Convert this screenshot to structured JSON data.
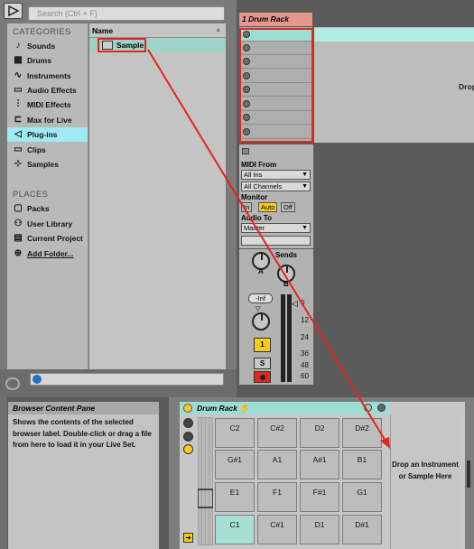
{
  "search": {
    "placeholder": "Search (Ctrl + F)"
  },
  "categories": {
    "title": "CATEGORIES",
    "items": [
      {
        "label": "Sounds",
        "icon": "note-icon"
      },
      {
        "label": "Drums",
        "icon": "drums-grid-icon"
      },
      {
        "label": "Instruments",
        "icon": "waveform-icon"
      },
      {
        "label": "Audio Effects",
        "icon": "audio-effects-icon"
      },
      {
        "label": "MIDI Effects",
        "icon": "midi-effects-icon"
      },
      {
        "label": "Max for Live",
        "icon": "max-icon"
      },
      {
        "label": "Plug-ins",
        "icon": "plugin-icon",
        "active": true
      },
      {
        "label": "Clips",
        "icon": "clip-icon"
      },
      {
        "label": "Samples",
        "icon": "samples-icon"
      }
    ]
  },
  "places": {
    "title": "PLACES",
    "items": [
      {
        "label": "Packs",
        "icon": "packs-icon"
      },
      {
        "label": "User Library",
        "icon": "user-icon"
      },
      {
        "label": "Current Project",
        "icon": "project-icon"
      },
      {
        "label": "Add Folder...",
        "icon": "add-icon"
      }
    ]
  },
  "file_list": {
    "header": "Name",
    "items": [
      "Sample"
    ]
  },
  "chain": {
    "title": "1 Drum Rack",
    "drop_hint": "Drop"
  },
  "io": {
    "midi_from_label": "MIDI From",
    "midi_from_value": "All Ins",
    "channel_value": "All Channels",
    "monitor_label": "Monitor",
    "monitor_in": "In",
    "monitor_auto": "Auto",
    "monitor_off": "Off",
    "audio_to_label": "Audio To",
    "audio_to_value": "Master"
  },
  "mixer": {
    "sends_label": "Sends",
    "send_a": "A",
    "send_b": "B",
    "volume_value": "-Inf",
    "track_number": "1",
    "solo_label": "S",
    "meter_scale": [
      "0",
      "12",
      "24",
      "36",
      "48",
      "60"
    ]
  },
  "info_pane": {
    "title": "Browser Content Pane",
    "text": "Shows the contents of the selected browser label. Double-click or drag a file from here to load it in your Live Set."
  },
  "device": {
    "title": "Drum Rack",
    "pads": [
      [
        "C2",
        "C#2",
        "D2",
        "D#2"
      ],
      [
        "G#1",
        "A1",
        "A#1",
        "B1"
      ],
      [
        "E1",
        "F1",
        "F#1",
        "G1"
      ],
      [
        "C1",
        "C#1",
        "D1",
        "D#1"
      ]
    ],
    "drop_text": "Drop an Instrument or Sample Here"
  },
  "colors": {
    "accent_active": "#9feaf5",
    "selection": "#9ed3c8",
    "chain_title": "#e5978d",
    "annotation_red": "#e5261a",
    "track_yellow": "#f6cc1a"
  }
}
